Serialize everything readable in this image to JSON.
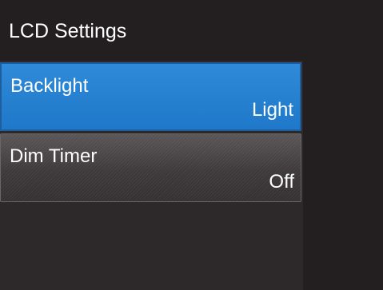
{
  "header": {
    "title": "LCD Settings"
  },
  "menu": {
    "items": [
      {
        "label": "Backlight",
        "value": "Light",
        "selected": true
      },
      {
        "label": "Dim Timer",
        "value": "Off",
        "selected": false
      }
    ]
  },
  "colors": {
    "background": "#231f20",
    "selected_item": "#2b86d6",
    "normal_item": "#4a4647",
    "text": "#ffffff"
  }
}
